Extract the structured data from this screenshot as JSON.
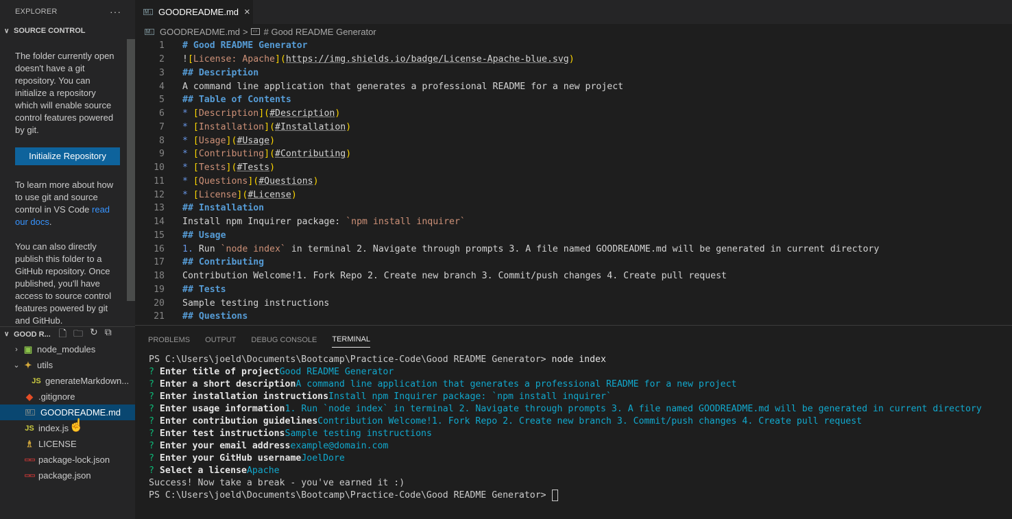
{
  "sidebar": {
    "title": "EXPLORER",
    "more_icon": "ellipsis-icon",
    "source_control": {
      "header": "SOURCE CONTROL",
      "message1": "The folder currently open doesn't have a git repository. You can initialize a repository which will enable source control features powered by git.",
      "init_button": "Initialize Repository",
      "message2_prefix": "To learn more about how to use git and source control in VS Code ",
      "message2_link": "read our docs",
      "message2_suffix": ".",
      "message3": "You can also directly publish this folder to a GitHub repository. Once published, you'll have access to source control features powered by git and GitHub."
    },
    "explorer": {
      "folder_name": "GOOD R...",
      "actions": [
        "new-file-icon",
        "new-folder-icon",
        "refresh-icon",
        "collapse-all-icon"
      ],
      "items": [
        {
          "label": "node_modules",
          "type": "folder",
          "icon": "node-folder-icon",
          "expanded": false
        },
        {
          "label": "utils",
          "type": "folder",
          "icon": "folder-icon",
          "expanded": true
        },
        {
          "label": "generateMarkdown...",
          "type": "js",
          "icon": "js-icon",
          "indent": true
        },
        {
          "label": ".gitignore",
          "type": "git",
          "icon": "git-icon"
        },
        {
          "label": "GOODREADME.md",
          "type": "md",
          "icon": "markdown-icon",
          "selected": true
        },
        {
          "label": "index.js",
          "type": "js",
          "icon": "js-icon"
        },
        {
          "label": "LICENSE",
          "type": "license",
          "icon": "license-icon"
        },
        {
          "label": "package-lock.json",
          "type": "json",
          "icon": "npm-icon"
        },
        {
          "label": "package.json",
          "type": "json",
          "icon": "npm-icon"
        }
      ]
    }
  },
  "editor": {
    "tab": {
      "label": "GOODREADME.md",
      "close": "×"
    },
    "breadcrumb": {
      "file": "GOODREADME.md",
      "separator": ">",
      "symbol": "# Good README Generator"
    },
    "lines": [
      "# Good README Generator",
      "![License: Apache](https://img.shields.io/badge/License-Apache-blue.svg)",
      "## Description",
      "A command line application that generates a professional README for a new project",
      "## Table of Contents",
      "* [Description](#Description)",
      "* [Installation](#Installation)",
      "* [Usage](#Usage)",
      "* [Contributing](#Contributing)",
      "* [Tests](#Tests)",
      "* [Questions](#Questions)",
      "* [License](#License)",
      "## Installation",
      "Install npm Inquirer package: `npm install inquirer`",
      "## Usage",
      "1. Run `node index` in terminal 2. Navigate through prompts 3. A file named GOODREADME.md will be generated in current directory",
      "## Contributing",
      "Contribution Welcome!1. Fork Repo 2. Create new branch 3. Commit/push changes 4. Create pull request",
      "## Tests",
      "Sample testing instructions",
      "## Questions"
    ]
  },
  "panel": {
    "tabs": [
      "PROBLEMS",
      "OUTPUT",
      "DEBUG CONSOLE",
      "TERMINAL"
    ],
    "active_tab": "TERMINAL",
    "terminal": {
      "prompt": "PS C:\\Users\\joeld\\Documents\\Bootcamp\\Practice-Code\\Good README Generator> ",
      "command": "node index",
      "qa": [
        {
          "q": "Enter title of project",
          "a": "Good README Generator"
        },
        {
          "q": "Enter a short description",
          "a": "A command line application that generates a professional README for a new project"
        },
        {
          "q": "Enter installation instructions",
          "a": "Install npm Inquirer package: `npm install inquirer`"
        },
        {
          "q": "Enter usage information",
          "a": "1. Run `node index` in terminal 2. Navigate through prompts 3. A file named GOODREADME.md will be generated in current directory"
        },
        {
          "q": "Enter contribution guidelines",
          "a": "Contribution Welcome!1. Fork Repo 2. Create new branch 3. Commit/push changes 4. Create pull request"
        },
        {
          "q": "Enter test instructions",
          "a": "Sample testing instructions"
        },
        {
          "q": "Enter your email address",
          "a": "example@domain.com"
        },
        {
          "q": "Enter your GitHub username",
          "a": "JoelDore"
        },
        {
          "q": "Select a license",
          "a": "Apache"
        }
      ],
      "success": "Success! Now take a break - you've earned it :)",
      "final_prompt": "PS C:\\Users\\joeld\\Documents\\Bootcamp\\Practice-Code\\Good README Generator> "
    }
  },
  "colors": {
    "accent": "#0e639c",
    "selection": "#094771",
    "heading": "#569cd6",
    "link_text": "#ce9178",
    "terminal_answer": "#11a8cd",
    "terminal_question_mark": "#0dbc79"
  }
}
